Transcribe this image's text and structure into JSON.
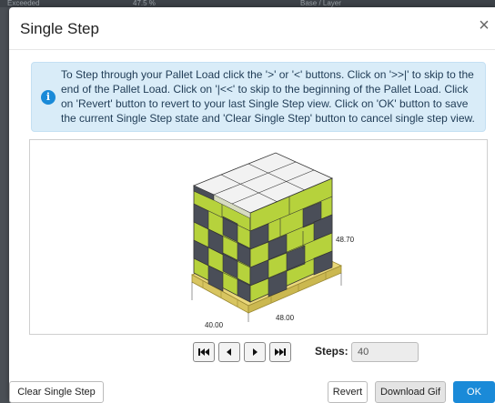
{
  "background": {
    "strip_left": "Exceeded",
    "strip_mid": "47.5 %",
    "strip_right": "Base / Layer"
  },
  "modal": {
    "title": "Single Step",
    "close_symbol": "×",
    "info_icon": "i",
    "info_text": "To Step through your Pallet Load click the '>' or '<' buttons. Click on '>>|' to skip to the end of the Pallet Load. Click on '|<<' to skip to the beginning of the Pallet Load. Click on 'Revert' button to revert to your last Single Step view. Click on 'OK' button to save the current Single Step state and 'Clear Single Step' button to cancel single step view."
  },
  "viewer": {
    "height_label": "48.70",
    "length_label": "40.00",
    "width_label": "48.00"
  },
  "controls": {
    "first_icon": "skip-to-start-icon",
    "prev_icon": "step-back-icon",
    "next_icon": "step-forward-icon",
    "last_icon": "skip-to-end-icon",
    "steps_label": "Steps:",
    "steps_value": "40"
  },
  "footer": {
    "clear_label": "Clear Single Step",
    "revert_label": "Revert",
    "gif_label": "Download Gif",
    "ok_label": "OK"
  },
  "colors": {
    "box_green": "#b6d23c",
    "box_gray": "#4a4e58",
    "box_white": "#f2f2f2",
    "pallet": "#e9d77a",
    "primary": "#1a8ad8"
  }
}
